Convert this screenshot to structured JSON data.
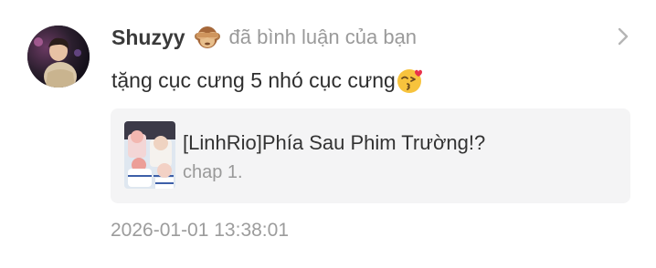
{
  "notification": {
    "username": "Shuzyy",
    "badge_icon": "see-no-evil-monkey-emoji",
    "action_text": "đã bình luận của bạn",
    "comment_text": "tặng cục cưng 5 nhó cục cưng",
    "comment_emoji": "kissing-heart-emoji",
    "chevron_icon": "chevron-right-icon",
    "timestamp": "2026-01-01 13:38:01"
  },
  "linked_post": {
    "title": "[LinhRio]Phía Sau Phim Trường!?",
    "subtitle": "chap 1.",
    "thumbnail": "post-thumbnail"
  },
  "colors": {
    "username": "#3a3a3a",
    "action_text": "#9a9a9a",
    "comment_text": "#2e2e2e",
    "card_background": "#f4f4f5",
    "timestamp": "#9c9c9c"
  }
}
